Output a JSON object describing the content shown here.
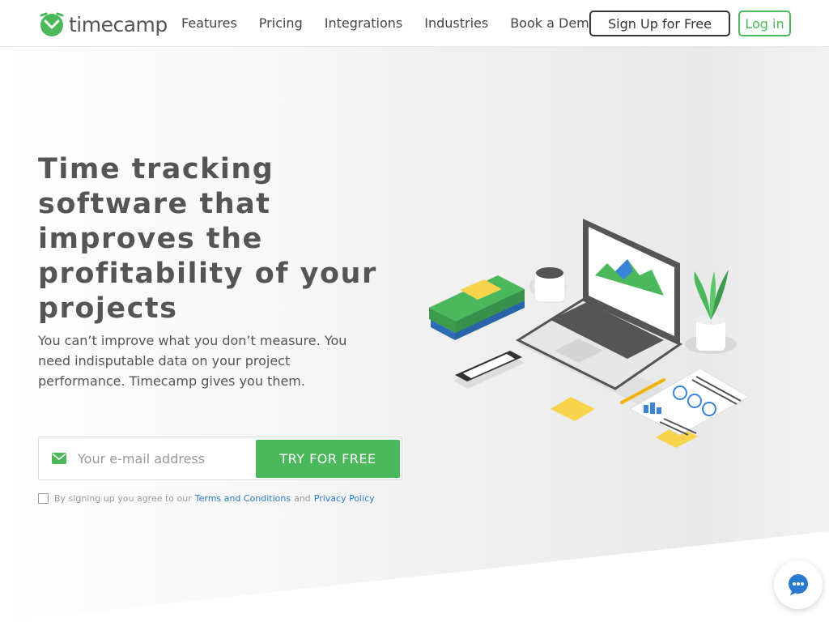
{
  "brand": {
    "name": "timecamp",
    "accent": "#4cb85c",
    "link_color": "#2a7bd0"
  },
  "nav": {
    "items": [
      {
        "label": "Features"
      },
      {
        "label": "Pricing"
      },
      {
        "label": "Integrations"
      },
      {
        "label": "Industries"
      },
      {
        "label": "Book a Demo"
      }
    ],
    "signup_label": "Sign Up for Free",
    "login_label": "Log in"
  },
  "hero": {
    "title": "Time tracking software that improves the profitability of your projects",
    "subtitle": "You can’t improve what you don’t measure. You need indisputable data on your project performance. Timecamp gives you them."
  },
  "form": {
    "email_placeholder": "Your e-mail address",
    "email_value": "",
    "submit_label": "TRY FOR FREE",
    "terms_prefix": "By signing up you agree to our",
    "terms_link": "Terms and Conditions",
    "terms_and": "and",
    "privacy_link": "Privacy Policy",
    "terms_checked": false
  },
  "icons": {
    "logo": "timecamp-logo-icon",
    "mail": "envelope-icon",
    "chat": "chat-bubble-icon"
  }
}
